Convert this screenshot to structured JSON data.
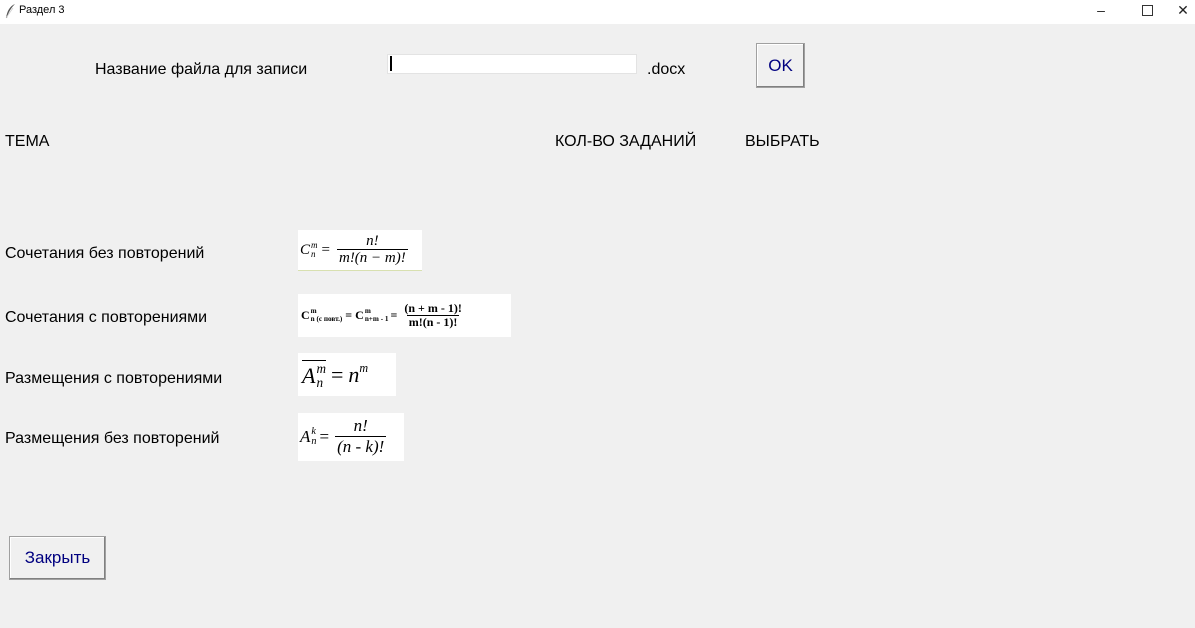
{
  "window": {
    "title": "Раздел 3",
    "minimize": "–",
    "close": "✕"
  },
  "file": {
    "label": "Название файла для записи",
    "value": "",
    "extension": ".docx",
    "ok_label": "OK"
  },
  "headers": {
    "topic": "ТЕМА",
    "count": "КОЛ-ВО ЗАДАНИЙ",
    "select": "ВЫБРАТЬ"
  },
  "topics": [
    {
      "label": "Сочетания без повторений",
      "formula": {
        "base": "C",
        "sup": "m",
        "sub": "n",
        "eq": "=",
        "num": "n!",
        "den": "m!(n − m)!"
      }
    },
    {
      "label": "Сочетания с повторениями",
      "formula": {
        "base": "C",
        "sup": "m",
        "sub": "n (с повт.)",
        "eq": "=",
        "base2": "C",
        "sup2": "m",
        "sub2": "n+m - 1",
        "eq2": "=",
        "num": "(n + m - 1)!",
        "den": "m!(n - 1)!"
      }
    },
    {
      "label": "Размещения с повторениями",
      "formula": {
        "base": "A",
        "sup": "m",
        "sub": "n",
        "eq": "=",
        "rhs": "n",
        "rhs_sup": "m"
      }
    },
    {
      "label": "Размещения без повторений",
      "formula": {
        "base": "A",
        "sup": "k",
        "sub": "n",
        "eq": "=",
        "num": "n!",
        "den": "(n - k)!"
      }
    }
  ],
  "close_label": "Закрыть",
  "icons": [
    "feather-icon",
    "minimize-icon",
    "maximize-icon",
    "close-icon"
  ]
}
